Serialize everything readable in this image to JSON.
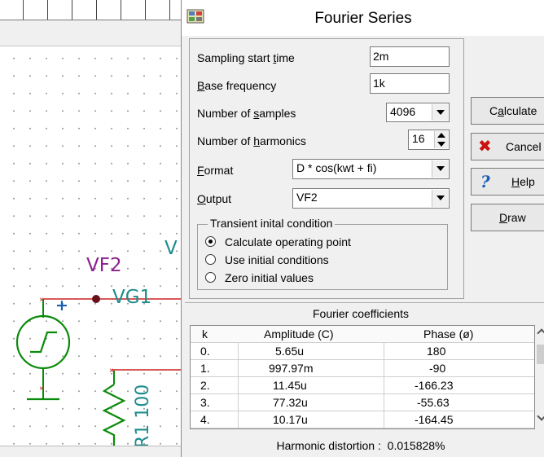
{
  "schematic": {
    "net_label_vf2": "VF2",
    "label_vg1": "VG1",
    "plus_sign": "+",
    "resistor_label": "R1 100",
    "partial_label": "V"
  },
  "dialog": {
    "title": "Fourier Series",
    "fields": {
      "sampling_start_time": {
        "label_pre": "Sampling start ",
        "label_key": "t",
        "label_post": "ime",
        "value": "2m"
      },
      "base_frequency": {
        "label_pre": "",
        "label_key": "B",
        "label_post": "ase frequency",
        "value": "1k"
      },
      "number_of_samples": {
        "label_pre": "Number of ",
        "label_key": "s",
        "label_post": "amples",
        "value": "4096"
      },
      "number_of_harmonics": {
        "label_pre": "Number of ",
        "label_key": "h",
        "label_post": "armonics",
        "value": "16"
      },
      "format": {
        "label_pre": "",
        "label_key": "F",
        "label_post": "ormat",
        "value": "D * cos(kwt + fi)"
      },
      "output": {
        "label_pre": "",
        "label_key": "O",
        "label_post": "utput",
        "value": "VF2"
      }
    },
    "transient": {
      "legend": "Transient inital condition",
      "options": [
        {
          "label": "Calculate operating point",
          "selected": true
        },
        {
          "label": "Use initial conditions",
          "selected": false
        },
        {
          "label": "Zero initial values",
          "selected": false
        }
      ]
    },
    "buttons": {
      "calculate": {
        "pre": "C",
        "key": "a",
        "post": "lculate"
      },
      "cancel": {
        "label": "Cancel",
        "icon": "x-icon"
      },
      "help": {
        "key": "H",
        "post": "elp",
        "icon": "question-icon"
      },
      "draw": {
        "key": "D",
        "post": "raw"
      }
    },
    "coefficients": {
      "title": "Fourier coefficients",
      "columns": [
        "k",
        "Amplitude (C)",
        "Phase (ø)"
      ],
      "rows": [
        [
          "0.",
          "5.65u",
          "180"
        ],
        [
          "1.",
          "997.97m",
          "-90"
        ],
        [
          "2.",
          "11.45u",
          "-166.23"
        ],
        [
          "3.",
          "77.32u",
          "-55.63"
        ],
        [
          "4.",
          "10.17u",
          "-164.45"
        ]
      ]
    },
    "distortion": {
      "label": "Harmonic distortion :",
      "value": "0.015828%"
    }
  },
  "colors": {
    "wire": "#cc2222",
    "component": "#0a8a0a",
    "net_label": "#8b1f8f",
    "teal_label": "#1e8c8c",
    "cancel_icon": "#cc1111",
    "help_icon": "#1a5fb4"
  }
}
